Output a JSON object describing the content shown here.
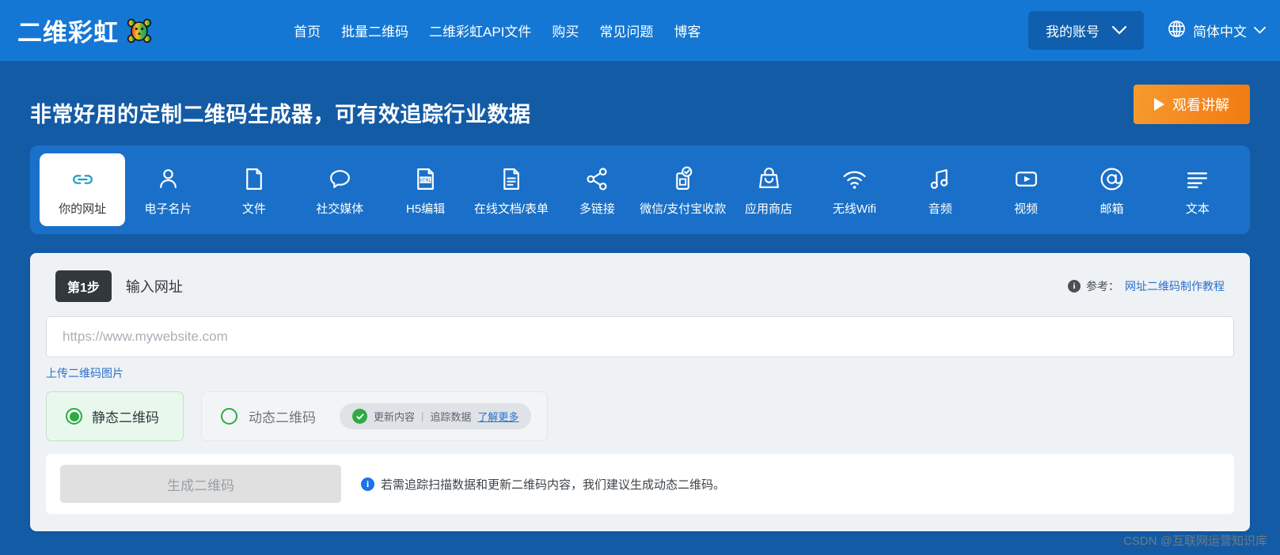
{
  "header": {
    "logo_text": "二维彩虹",
    "logo_icon": "rainbow-bear-icon",
    "nav": [
      {
        "label": "首页"
      },
      {
        "label": "批量二维码"
      },
      {
        "label": "二维彩虹API文件"
      },
      {
        "label": "购买"
      },
      {
        "label": "常见问题"
      },
      {
        "label": "博客"
      }
    ],
    "account_label": "我的账号",
    "account_chevron": "chevron-down-icon",
    "language_icon": "globe-icon",
    "language_label": "简体中文",
    "language_chevron": "chevron-down-icon",
    "bg_color": "#1477d4"
  },
  "hero": {
    "title": "非常好用的定制二维码生成器，可有效追踪行业数据",
    "watch_button": "观看讲解",
    "watch_icon": "play-icon",
    "bg_color": "#135ba5",
    "accent_color": "#f5871f"
  },
  "tabs": {
    "active_index": 0,
    "panel_color": "#1a70c8",
    "items": [
      {
        "label": "你的网址",
        "icon": "link-icon"
      },
      {
        "label": "电子名片",
        "icon": "person-icon"
      },
      {
        "label": "文件",
        "icon": "file-icon"
      },
      {
        "label": "社交媒体",
        "icon": "speech-bubble-icon"
      },
      {
        "label": "H5编辑",
        "icon": "html-file-icon"
      },
      {
        "label": "在线文档/表单",
        "icon": "document-lines-icon"
      },
      {
        "label": "多链接",
        "icon": "share-icon"
      },
      {
        "label": "微信/支付宝收款",
        "icon": "payment-qr-check-icon"
      },
      {
        "label": "应用商店",
        "icon": "shopping-bag-icon"
      },
      {
        "label": "无线Wifi",
        "icon": "wifi-icon"
      },
      {
        "label": "音频",
        "icon": "music-note-icon"
      },
      {
        "label": "视频",
        "icon": "video-play-icon"
      },
      {
        "label": "邮箱",
        "icon": "at-sign-icon"
      },
      {
        "label": "文本",
        "icon": "text-lines-icon"
      }
    ]
  },
  "step_card": {
    "badge": "第1步",
    "title": "输入网址",
    "reference_icon": "info-icon",
    "reference_label": "参考：",
    "reference_link": "网址二维码制作教程",
    "url_input_value": "",
    "url_input_placeholder": "https://www.mywebsite.com",
    "upload_link": "上传二维码图片",
    "static_mode": {
      "label": "静态二维码",
      "selected": true,
      "accent_color": "#2faa46"
    },
    "dynamic_mode": {
      "label": "动态二维码",
      "selected": false,
      "badge_check_icon": "check-circle-icon",
      "badge_text_1": "更新内容",
      "badge_separator": "|",
      "badge_text_2": "追踪数据",
      "badge_link": "了解更多"
    },
    "generate_button": "生成二维码",
    "generate_disabled": true,
    "note_icon": "info-icon",
    "note_text": "若需追踪扫描数据和更新二维码内容，我们建议生成动态二维码。"
  },
  "watermark": "CSDN @互联网运营知识库"
}
